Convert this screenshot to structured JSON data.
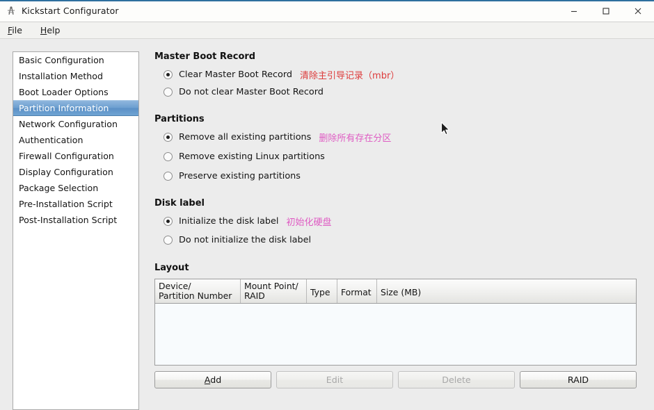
{
  "window": {
    "title": "Kickstart Configurator",
    "icon": "app-icon",
    "controls": {
      "minimize": "minimize-icon",
      "maximize": "maximize-icon",
      "close": "close-icon"
    }
  },
  "menubar": {
    "items": [
      {
        "label": "File",
        "accel": "F",
        "rest": "ile"
      },
      {
        "label": "Help",
        "accel": "H",
        "rest": "elp"
      }
    ]
  },
  "sidebar": {
    "items": [
      {
        "label": "Basic Configuration",
        "selected": false
      },
      {
        "label": "Installation Method",
        "selected": false
      },
      {
        "label": "Boot Loader Options",
        "selected": false
      },
      {
        "label": "Partition Information",
        "selected": true
      },
      {
        "label": "Network Configuration",
        "selected": false
      },
      {
        "label": "Authentication",
        "selected": false
      },
      {
        "label": "Firewall Configuration",
        "selected": false
      },
      {
        "label": "Display Configuration",
        "selected": false
      },
      {
        "label": "Package Selection",
        "selected": false
      },
      {
        "label": "Pre-Installation Script",
        "selected": false
      },
      {
        "label": "Post-Installation Script",
        "selected": false
      }
    ]
  },
  "main": {
    "mbr": {
      "title": "Master Boot Record",
      "options": [
        {
          "label": "Clear Master Boot Record",
          "checked": true,
          "annotation": "清除主引导记录（mbr）",
          "annotation_color": "#dd3b3b"
        },
        {
          "label": "Do not clear Master Boot Record",
          "checked": false,
          "annotation": "",
          "annotation_color": ""
        }
      ]
    },
    "partitions": {
      "title": "Partitions",
      "options": [
        {
          "label": "Remove all existing partitions",
          "checked": true,
          "annotation": "删除所有存在分区",
          "annotation_color": "#df5cc3"
        },
        {
          "label": "Remove existing Linux partitions",
          "checked": false,
          "annotation": "",
          "annotation_color": ""
        },
        {
          "label": "Preserve existing partitions",
          "checked": false,
          "annotation": "",
          "annotation_color": ""
        }
      ]
    },
    "disk_label": {
      "title": "Disk label",
      "options": [
        {
          "label": "Initialize the disk label",
          "checked": true,
          "annotation": "初始化硬盘",
          "annotation_color": "#df5cc3"
        },
        {
          "label": "Do not initialize the disk label",
          "checked": false,
          "annotation": "",
          "annotation_color": ""
        }
      ]
    },
    "layout": {
      "title": "Layout",
      "columns": [
        "Device/\nPartition Number",
        "Mount Point/\nRAID",
        "Type",
        "Format",
        "Size (MB)"
      ],
      "rows": [],
      "buttons": [
        {
          "label": "Add",
          "accel": "A",
          "rest": "dd",
          "enabled": true
        },
        {
          "label": "Edit",
          "accel": "",
          "rest": "Edit",
          "enabled": false
        },
        {
          "label": "Delete",
          "accel": "",
          "rest": "Delete",
          "enabled": false
        },
        {
          "label": "RAID",
          "accel": "",
          "rest": "RAID",
          "enabled": true
        }
      ]
    }
  }
}
